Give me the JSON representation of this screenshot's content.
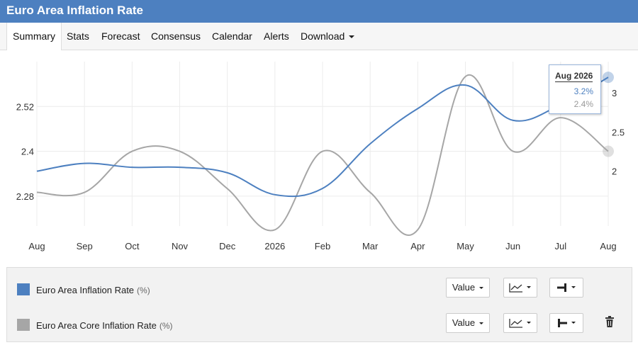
{
  "header": {
    "title": "Euro Area Inflation Rate"
  },
  "tabs": [
    {
      "label": "Summary",
      "active": true
    },
    {
      "label": "Stats"
    },
    {
      "label": "Forecast"
    },
    {
      "label": "Consensus"
    },
    {
      "label": "Calendar"
    },
    {
      "label": "Alerts"
    },
    {
      "label": "Download"
    }
  ],
  "tooltip": {
    "date": "Aug 2026",
    "value1": "3.2%",
    "value2": "2.4%"
  },
  "chart_data": {
    "type": "line",
    "categories": [
      "Aug",
      "Sep",
      "Oct",
      "Nov",
      "Dec",
      "2026",
      "Feb",
      "Mar",
      "Apr",
      "May",
      "Jun",
      "Jul",
      "Aug"
    ],
    "left_axis": {
      "ticks": [
        "2.28",
        "2.4",
        "2.52"
      ],
      "range": [
        2.2,
        2.64
      ]
    },
    "right_axis": {
      "ticks": [
        "2",
        "2.5",
        "3"
      ],
      "range": [
        1.3,
        3.4
      ]
    },
    "series": [
      {
        "name": "Euro Area Inflation Rate",
        "axis": "right",
        "color": "#4d80c0",
        "values": [
          2.0,
          2.1,
          2.05,
          2.05,
          1.98,
          1.7,
          1.78,
          2.35,
          2.8,
          3.1,
          2.65,
          2.85,
          3.2
        ]
      },
      {
        "name": "Euro Area Core Inflation Rate",
        "axis": "left",
        "color": "#a6a6a6",
        "values": [
          2.29,
          2.29,
          2.4,
          2.4,
          2.3,
          2.19,
          2.4,
          2.29,
          2.19,
          2.6,
          2.4,
          2.49,
          2.4
        ]
      }
    ],
    "grid": true,
    "legend": "bottom"
  },
  "legend": {
    "items": [
      {
        "name": "Euro Area Inflation Rate",
        "unit": "(%)",
        "color": "#4d80c0",
        "value_label": "Value"
      },
      {
        "name": "Euro Area Core Inflation Rate",
        "unit": "(%)",
        "color": "#a6a6a6",
        "value_label": "Value"
      }
    ]
  }
}
